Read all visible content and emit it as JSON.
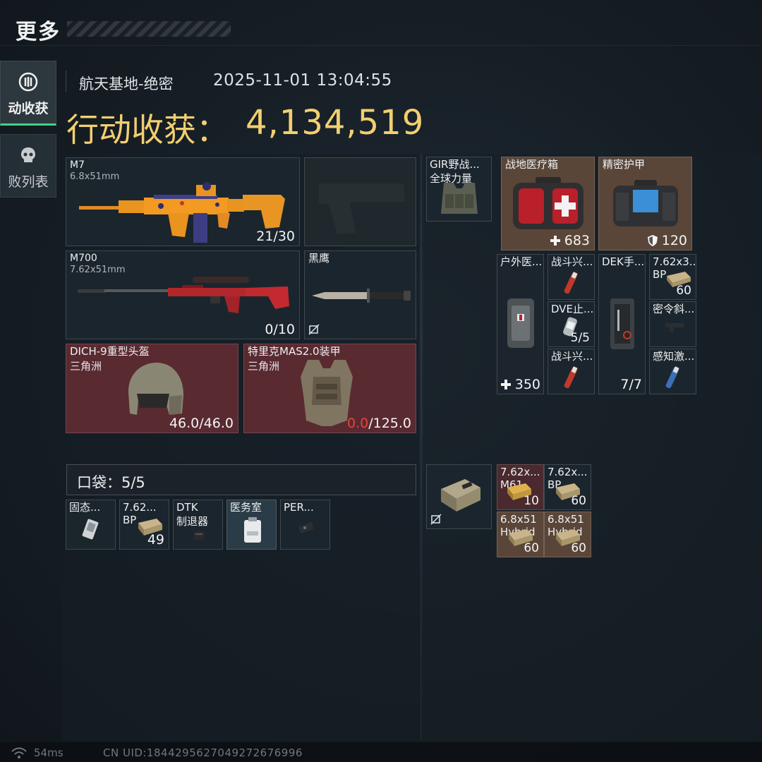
{
  "header": {
    "title": "更多"
  },
  "sidebar": {
    "tabs": [
      {
        "label": "动收获",
        "icon": "loot-icon",
        "active": true
      },
      {
        "label": "败列表",
        "icon": "skull-icon",
        "active": false
      }
    ]
  },
  "summary": {
    "map": "航天基地-绝密",
    "datetime": "2025-11-01 13:04:55",
    "haul_label": "行动收获：",
    "haul_value": "4,134,519"
  },
  "weapons": [
    {
      "name": "M7",
      "caliber": "6.8x51mm",
      "ammo": "21/30",
      "icon": "assault-rifle-icon"
    },
    {
      "name": "",
      "caliber": "",
      "ammo": "",
      "icon": "pistol-silhouette-icon"
    },
    {
      "name": "M700",
      "caliber": "7.62x51mm",
      "ammo": "0/10",
      "icon": "sniper-rifle-icon"
    },
    {
      "name": "黑鹰",
      "caliber": "",
      "ammo": "",
      "icon": "knife-icon"
    }
  ],
  "armor": {
    "helmet": {
      "name": "DICH-9重型头盔",
      "maker": "三角洲",
      "durability_current": "46.0",
      "durability_sep": "/46.0"
    },
    "vest": {
      "name": "特里克MAS2.0装甲",
      "maker": "三角洲",
      "durability_current": "0.0",
      "durability_sep": "/125.0"
    }
  },
  "pockets": {
    "label": "口袋：5/5",
    "items": [
      {
        "name": "固态...",
        "sub": "",
        "count": ""
      },
      {
        "name": "7.62...",
        "sub": "BP",
        "count": "49"
      },
      {
        "name": "DTK",
        "sub": "制退器",
        "count": ""
      },
      {
        "name": "医务室",
        "sub": "",
        "count": ""
      },
      {
        "name": "PER...",
        "sub": "",
        "count": ""
      }
    ]
  },
  "rig": {
    "name": "GIR野战...",
    "sub": "全球力量"
  },
  "backpack_top": [
    {
      "name": "战地医疗箱",
      "count": "683",
      "count_icon": "plus-icon"
    },
    {
      "name": "精密护甲",
      "count": "120",
      "count_icon": "shield-icon"
    }
  ],
  "container": {
    "large": [
      {
        "name": "户外医...",
        "count": "350",
        "count_icon": "plus-icon"
      },
      {
        "name": "DEK手...",
        "count": "7/7"
      }
    ],
    "small": [
      {
        "name": "战斗兴...",
        "sub": "",
        "count": ""
      },
      {
        "name": "DVE止...",
        "sub": "",
        "count": "5/5"
      },
      {
        "name": "战斗兴...",
        "sub": "",
        "count": ""
      },
      {
        "name": "7.62x3...",
        "sub": "BP",
        "count": "60"
      },
      {
        "name": "密令斜...",
        "sub": "",
        "count": ""
      },
      {
        "name": "感知激...",
        "sub": "",
        "count": ""
      }
    ]
  },
  "case_items": [
    {
      "name": "7.62x...",
      "sub": "M61",
      "count": "10"
    },
    {
      "name": "7.62x...",
      "sub": "BP",
      "count": "60"
    },
    {
      "name": "6.8x51",
      "sub": "Hybrid",
      "count": "60"
    },
    {
      "name": "6.8x51",
      "sub": "Hybrid",
      "count": "60"
    }
  ],
  "footer": {
    "ping": "54ms",
    "uid": "CN UID:1844295627049272676996"
  },
  "colors": {
    "accent_gold": "#f2cf70",
    "active_green": "#3fd28a",
    "durability_bad": "#e2443d"
  }
}
